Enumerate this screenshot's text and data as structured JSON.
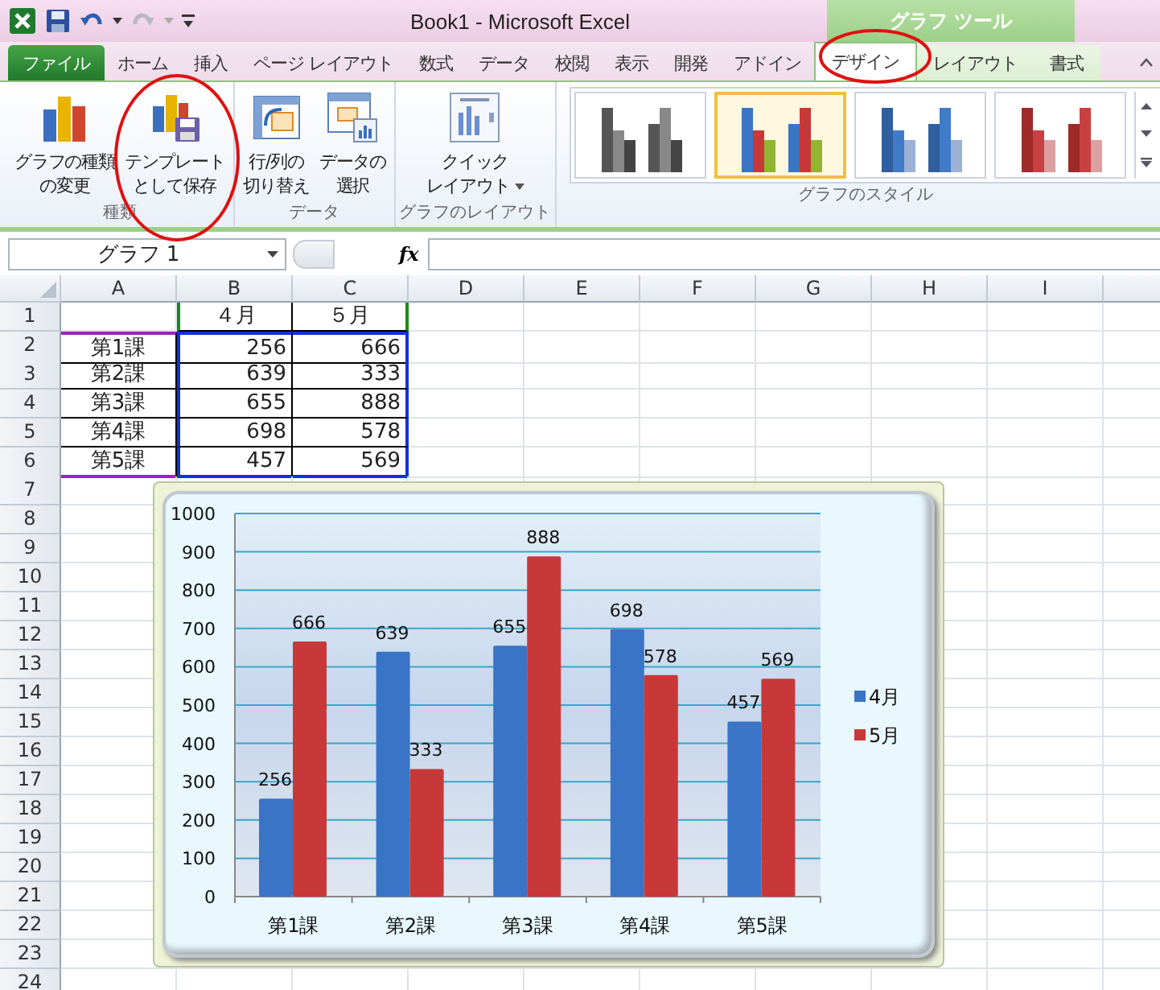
{
  "window": {
    "title": "Book1  -  Microsoft Excel",
    "context_header": "グラフ ツール"
  },
  "tabs": [
    {
      "label": "ファイル",
      "kind": "file",
      "selected": false
    },
    {
      "label": "ホーム",
      "kind": "normal",
      "selected": false
    },
    {
      "label": "挿入",
      "kind": "normal",
      "selected": false
    },
    {
      "label": "ページ レイアウト",
      "kind": "normal",
      "selected": false
    },
    {
      "label": "数式",
      "kind": "normal",
      "selected": false
    },
    {
      "label": "データ",
      "kind": "normal",
      "selected": false
    },
    {
      "label": "校閲",
      "kind": "normal",
      "selected": false
    },
    {
      "label": "表示",
      "kind": "normal",
      "selected": false
    },
    {
      "label": "開発",
      "kind": "normal",
      "selected": false
    },
    {
      "label": "アドイン",
      "kind": "normal",
      "selected": false
    },
    {
      "label": "デザイン",
      "kind": "contextual",
      "selected": true
    },
    {
      "label": "レイアウト",
      "kind": "contextual",
      "selected": false
    },
    {
      "label": "書式",
      "kind": "contextual",
      "selected": false
    }
  ],
  "ribbon": {
    "groups": [
      {
        "label": "種類",
        "buttons": [
          {
            "kind": "chart-type",
            "lines": [
              "グラフの種類",
              "の変更"
            ]
          },
          {
            "kind": "save-template",
            "lines": [
              "テンプレート",
              "として保存"
            ]
          }
        ]
      },
      {
        "label": "データ",
        "buttons": [
          {
            "kind": "switch",
            "lines": [
              "行/列の",
              "切り替え"
            ]
          },
          {
            "kind": "select-data",
            "lines": [
              "データの",
              "選択"
            ]
          }
        ]
      },
      {
        "label": "グラフのレイアウト",
        "buttons": [
          {
            "kind": "quick-layout",
            "lines": [
              "クイック",
              "レイアウト"
            ],
            "dropdown": true
          }
        ]
      }
    ],
    "styles_group": {
      "label": "グラフのスタイル",
      "styles": [
        {
          "selected": false
        },
        {
          "selected": true
        },
        {
          "selected": false
        },
        {
          "selected": false
        }
      ]
    }
  },
  "formula_bar": {
    "name_box": "グラフ 1",
    "function_button": "fx"
  },
  "sheet": {
    "columns": [
      "A",
      "B",
      "C",
      "D",
      "E",
      "F",
      "G",
      "H",
      "I"
    ],
    "header_row": {
      "number": "1",
      "cells": [
        "４月",
        "５月"
      ]
    },
    "data_rows": [
      {
        "number": "2",
        "label": "第1課",
        "values": [
          "256",
          "666"
        ]
      },
      {
        "number": "3",
        "label": "第2課",
        "values": [
          "639",
          "333"
        ]
      },
      {
        "number": "4",
        "label": "第3課",
        "values": [
          "655",
          "888"
        ]
      },
      {
        "number": "5",
        "label": "第4課",
        "values": [
          "698",
          "578"
        ]
      },
      {
        "number": "6",
        "label": "第5課",
        "values": [
          "457",
          "569"
        ]
      }
    ],
    "empty_rows": [
      "7",
      "8",
      "9",
      "10",
      "11",
      "12",
      "13",
      "14",
      "15",
      "16",
      "17",
      "18",
      "19",
      "20",
      "21",
      "22",
      "23",
      "24"
    ]
  },
  "chart": {
    "chart_data": {
      "type": "bar",
      "categories": [
        "第1課",
        "第2課",
        "第3課",
        "第4課",
        "第5課"
      ],
      "series": [
        {
          "name": "4月",
          "color": "#3a74c6",
          "values": [
            256,
            639,
            655,
            698,
            457
          ],
          "value_labels": [
            "256",
            "639",
            "655",
            "698",
            "457"
          ]
        },
        {
          "name": "5月",
          "color": "#c93838",
          "values": [
            666,
            333,
            888,
            578,
            569
          ],
          "value_labels": [
            "666",
            "333",
            "888",
            "578",
            "569"
          ]
        }
      ],
      "ylim": [
        0,
        1000
      ],
      "grid": true,
      "legend": true,
      "yticks": [
        0,
        100,
        200,
        300,
        400,
        500,
        600,
        700,
        800,
        900,
        1000
      ],
      "data_labels": true
    }
  }
}
